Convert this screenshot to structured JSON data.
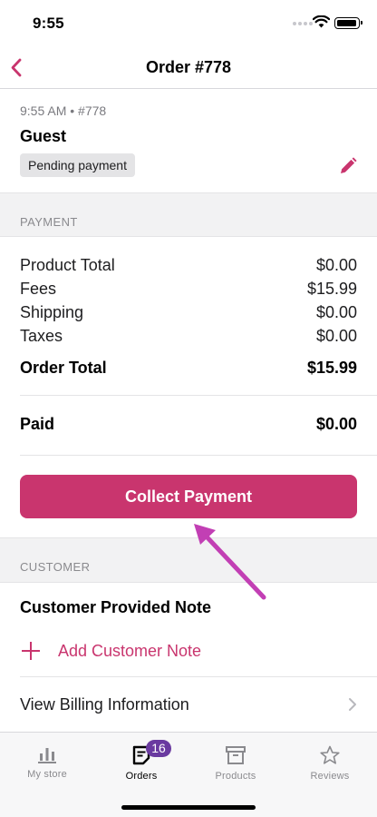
{
  "status_bar": {
    "time": "9:55"
  },
  "nav": {
    "title": "Order #778"
  },
  "summary": {
    "meta": "9:55 AM • #778",
    "customer": "Guest",
    "status": "Pending payment"
  },
  "payment": {
    "header": "PAYMENT",
    "rows": [
      {
        "label": "Product Total",
        "value": "$0.00"
      },
      {
        "label": "Fees",
        "value": "$15.99"
      },
      {
        "label": "Shipping",
        "value": "$0.00"
      },
      {
        "label": "Taxes",
        "value": "$0.00"
      }
    ],
    "order_total_label": "Order Total",
    "order_total_value": "$15.99",
    "paid_label": "Paid",
    "paid_value": "$0.00",
    "collect_button": "Collect Payment"
  },
  "customer": {
    "header": "CUSTOMER",
    "note_title": "Customer Provided Note",
    "add_note": "Add Customer Note",
    "billing": "View Billing Information"
  },
  "tab_bar": {
    "tabs": [
      {
        "label": "My store",
        "icon": "bar-chart-icon",
        "active": false
      },
      {
        "label": "Orders",
        "icon": "orders-icon",
        "active": true,
        "badge": "16"
      },
      {
        "label": "Products",
        "icon": "archive-box-icon",
        "active": false
      },
      {
        "label": "Reviews",
        "icon": "star-icon",
        "active": false
      }
    ]
  },
  "colors": {
    "accent": "#c9356e",
    "badge": "#6a3aa0",
    "annotation_arrow": "#c23fb4"
  }
}
